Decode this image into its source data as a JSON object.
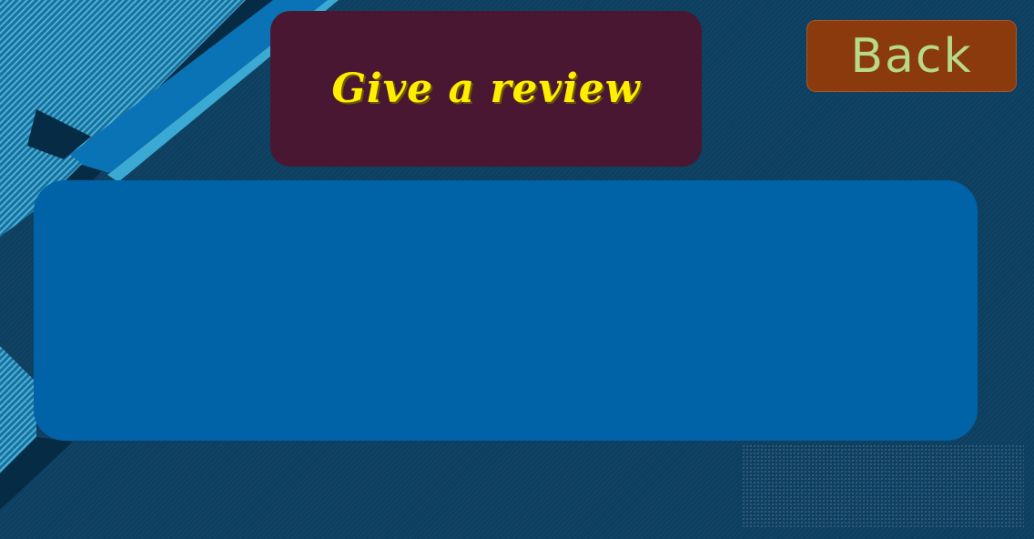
{
  "header": {
    "title": "Give a review"
  },
  "nav": {
    "back_label": "Back"
  },
  "review": {
    "value": "",
    "placeholder": ""
  },
  "colors": {
    "background": "#0d3f60",
    "title_panel": "#4a1732",
    "title_text": "#ffee00",
    "back_button": "#8a3a0c",
    "back_text": "#b7d989",
    "review_area": "#0063a7",
    "stripe_light": "#3aa9d4",
    "stripe_mid": "#0a73b5"
  }
}
